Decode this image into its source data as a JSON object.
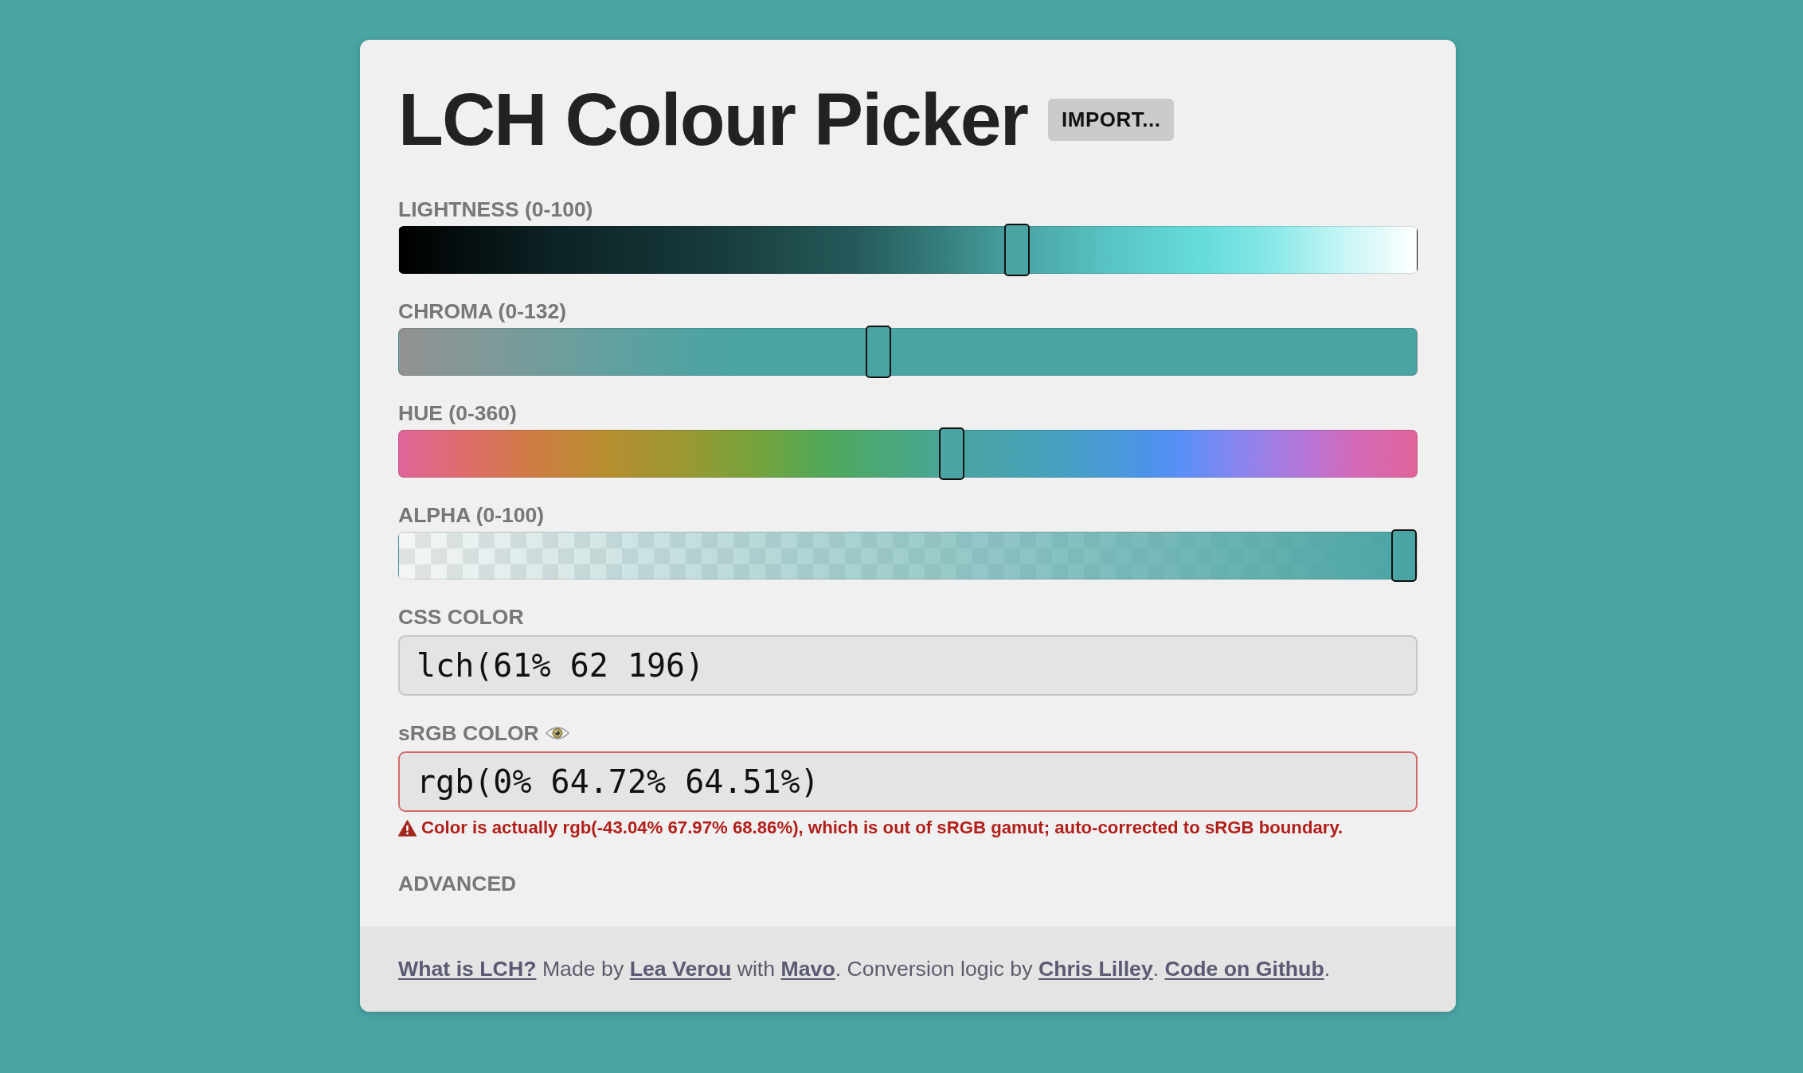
{
  "title": "LCH Colour Picker",
  "import_button": "IMPORT...",
  "sliders": [
    {
      "kind": "lightness",
      "label": "LIGHTNESS (0-100)",
      "level": 0.61
    },
    {
      "kind": "chroma",
      "label": "CHROMA (0-132)",
      "level": 0.47
    },
    {
      "kind": "hue",
      "label": "HUE (0-360)",
      "level": 0.544
    },
    {
      "kind": "alpha",
      "label": "ALPHA (0-100)",
      "level": 1
    }
  ],
  "css_color": {
    "label": "CSS COLOR",
    "value": "lch(61% 62 196)"
  },
  "srgb_color": {
    "label": "sRGB COLOR",
    "value": "rgb(0% 64.72% 64.51%)",
    "invalid": true,
    "warning": "Color is actually rgb(-43.04% 67.97% 68.86%), which is out of sRGB gamut; auto-corrected to sRGB boundary."
  },
  "advanced": "ADVANCED",
  "footer": [
    {
      "kind": "link",
      "text": "What is LCH?"
    },
    {
      "kind": "text",
      "text": " Made by "
    },
    {
      "kind": "link",
      "text": "Lea Verou"
    },
    {
      "kind": "text",
      "text": " with "
    },
    {
      "kind": "link",
      "text": "Mavo"
    },
    {
      "kind": "text",
      "text": ". Conversion logic by "
    },
    {
      "kind": "link",
      "text": "Chris Lilley"
    },
    {
      "kind": "text",
      "text": ". "
    },
    {
      "kind": "link",
      "text": "Code on Github"
    },
    {
      "kind": "text",
      "text": "."
    }
  ]
}
